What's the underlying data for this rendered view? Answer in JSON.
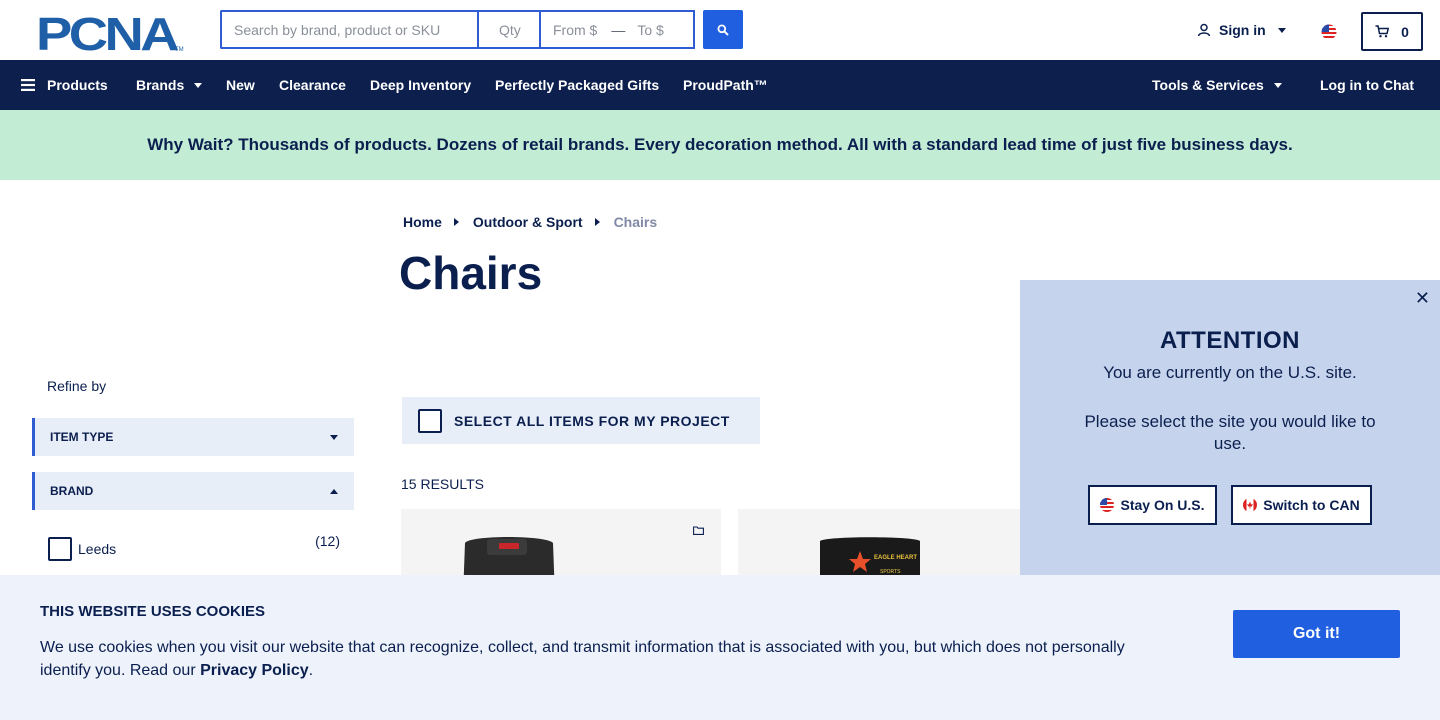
{
  "brand": {
    "logo_text": "PCNA",
    "tm": "TM"
  },
  "search": {
    "placeholder": "Search by brand, product or SKU",
    "qty_placeholder": "Qty",
    "from_placeholder": "From $",
    "to_placeholder": "To $",
    "range_separator": "—"
  },
  "header": {
    "sign_in_label": "Sign in",
    "cart_count": "0"
  },
  "nav": {
    "products": "Products",
    "brands": "Brands",
    "new": "New",
    "clearance": "Clearance",
    "deep_inventory": "Deep Inventory",
    "gifts": "Perfectly Packaged Gifts",
    "proudpath": "ProudPath™",
    "tools": "Tools & Services",
    "chat": "Log in to Chat"
  },
  "promo": {
    "text": "Why Wait? Thousands of products. Dozens of retail brands. Every decoration method. All with a standard lead time of just five business days."
  },
  "breadcrumb": {
    "home": "Home",
    "category": "Outdoor & Sport",
    "current": "Chairs"
  },
  "page": {
    "title": "Chairs"
  },
  "sidebar": {
    "refine_label": "Refine by",
    "facets": [
      {
        "label": "ITEM TYPE"
      },
      {
        "label": "BRAND"
      }
    ],
    "brand_options": [
      {
        "label": "Leeds",
        "count": "(12)"
      }
    ]
  },
  "listing": {
    "select_all_label": "SELECT ALL ITEMS FOR MY PROJECT",
    "results_label": "15 RESULTS",
    "card2_logo_text": "EAGLE HEART",
    "card2_sub_text": "SPORTS"
  },
  "attention": {
    "title": "ATTENTION",
    "line1": "You are currently on the U.S. site.",
    "line2": "Please select the site you would like to use.",
    "stay_label": "Stay On U.S.",
    "switch_label": "Switch to CAN",
    "close_glyph": "✕"
  },
  "cookies": {
    "title": "THIS WEBSITE USES COOKIES",
    "text": "We use cookies when you visit our website that can recognize, collect, and transmit information that is associated with you, but which does not personally identify you. Read our ",
    "link": "Privacy Policy",
    "period": ".",
    "button": "Got it!"
  },
  "colors": {
    "navy": "#0d1f4d",
    "accent_blue": "#1f5fe0",
    "promo_green": "#c3ecd5",
    "modal_blue": "#c5d4ec",
    "cookie_bg": "#edf2fb"
  }
}
